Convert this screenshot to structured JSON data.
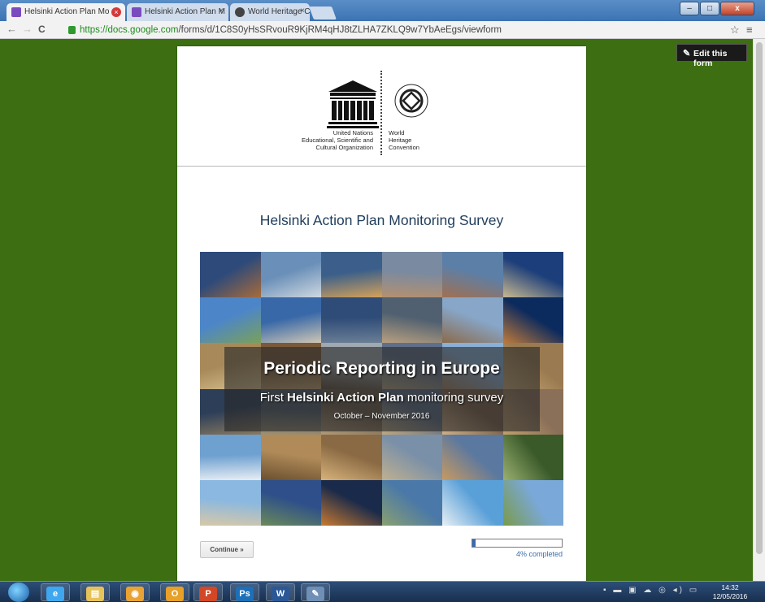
{
  "browser": {
    "tabs": [
      {
        "title": "Helsinki Action Plan Mo",
        "active": true
      },
      {
        "title": "Helsinki Action Plan M",
        "active": false
      },
      {
        "title": "World Heritage Centre",
        "active": false
      }
    ],
    "address": {
      "scheme_host": "https://docs.google.com",
      "path": "/forms/d/1C8S0yHsSRvouR9KjRM4qHJ8tZLHA7ZKLQ9w7YbAeEgs/viewform"
    },
    "window_controls": {
      "minimize": "–",
      "maximize": "□",
      "close": "x"
    },
    "nav": {
      "back": "←",
      "forward": "→",
      "reload": "C"
    },
    "star_icon": "☆",
    "menu_icon": "≡"
  },
  "page": {
    "background_color": "#3d6f12",
    "edit_button_label": "Edit this form",
    "logo": {
      "unesco_org_text": "United Nations\nEducational, Scientific and\nCultural Organization",
      "whc_text": "World\nHeritage\nConvention"
    },
    "survey_title": "Helsinki Action Plan Monitoring Survey",
    "banner": {
      "headline": "Periodic Reporting in Europe",
      "sub_prefix": "First ",
      "sub_bold": "Helsinki Action Plan",
      "sub_suffix": " monitoring survey",
      "dates": "October – November 2016"
    },
    "continue_label": "Continue »",
    "progress": {
      "fraction": 0.04,
      "label": "4% completed"
    }
  },
  "taskbar": {
    "apps": [
      {
        "name": "internet-explorer",
        "glyph": "e"
      },
      {
        "name": "file-explorer",
        "glyph": "▤"
      },
      {
        "name": "chrome",
        "glyph": "◉"
      },
      {
        "name": "outlook",
        "glyph": "O"
      },
      {
        "name": "powerpoint",
        "glyph": "P"
      },
      {
        "name": "photoshop",
        "glyph": "Ps"
      },
      {
        "name": "word",
        "glyph": "W"
      },
      {
        "name": "paint",
        "glyph": "✎"
      }
    ],
    "clock_time": "14:32",
    "clock_date": "12/05/2016"
  }
}
